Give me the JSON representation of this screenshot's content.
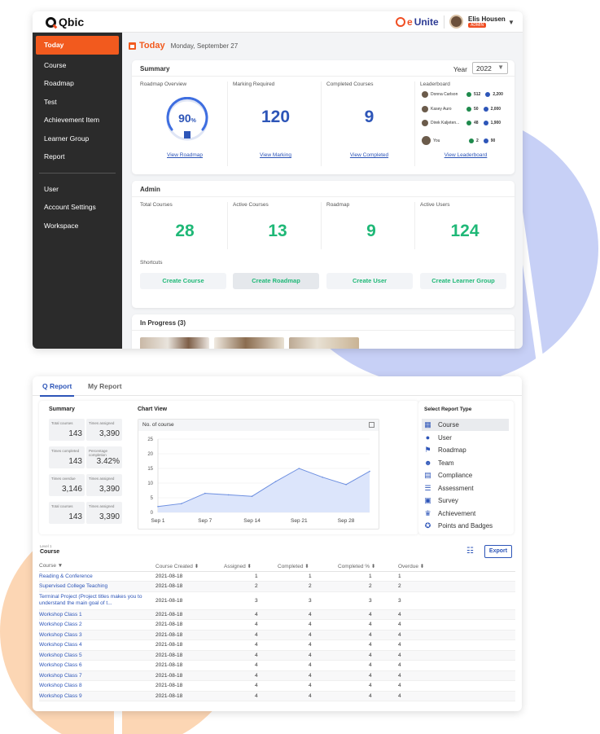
{
  "colors": {
    "accent": "#f25a1e",
    "brand_blue": "#2d55b8",
    "green": "#1fb877"
  },
  "app": {
    "logo": "Qbic",
    "partner_logo_e": "e",
    "partner_logo_rest": "Unite"
  },
  "user": {
    "name": "Elis Housen",
    "role": "ADMIN"
  },
  "sidebar": {
    "items": [
      "Today",
      "Course",
      "Roadmap",
      "Test",
      "Achievement Item",
      "Learner Group",
      "Report"
    ],
    "items2": [
      "User",
      "Account Settings",
      "Workspace"
    ]
  },
  "page": {
    "title": "Today",
    "date": "Monday, September 27"
  },
  "summary": {
    "heading": "Summary",
    "year_label": "Year",
    "year_value": "2022",
    "roadmap_title": "Roadmap Overview",
    "roadmap_percent": "90",
    "roadmap_unit": "%",
    "roadmap_link": "View Roadmap",
    "marking_title": "Marking Required",
    "marking_value": "120",
    "marking_link": "View Marking",
    "completed_title": "Completed Courses",
    "completed_value": "9",
    "completed_link": "View Completed",
    "leaderboard_title": "Leaderboard",
    "leaderboard_link": "View Leaderboard",
    "leaderboard": [
      {
        "name": "Donna Carlson",
        "g": "512",
        "b": "2,200"
      },
      {
        "name": "Kasey Auro",
        "g": "50",
        "b": "2,000"
      },
      {
        "name": "Direk Kaljeten...",
        "g": "48",
        "b": "1,900"
      },
      {
        "name": "You",
        "g": "2",
        "b": "90"
      }
    ]
  },
  "admin": {
    "heading": "Admin",
    "stats": [
      {
        "label": "Total Courses",
        "value": "28"
      },
      {
        "label": "Active Courses",
        "value": "13"
      },
      {
        "label": "Roadmap",
        "value": "9"
      },
      {
        "label": "Active Users",
        "value": "124"
      }
    ],
    "shortcuts_label": "Shortcuts",
    "shortcuts": [
      "Create Course",
      "Create Roadmap",
      "Create User",
      "Create Learner Group"
    ]
  },
  "in_progress": {
    "heading": "In Progress (3)"
  },
  "report": {
    "tabs": [
      "Q Report",
      "My Report"
    ],
    "summary_title": "Summary",
    "stats": [
      {
        "label": "Total courses",
        "value": "143"
      },
      {
        "label": "Times assigned",
        "value": "3,390"
      },
      {
        "label": "Times completed",
        "value": "143"
      },
      {
        "label": "Percentage completion",
        "value": "3.42%"
      },
      {
        "label": "Times overdue",
        "value": "3,146"
      },
      {
        "label": "Times assigned",
        "value": "3,390"
      },
      {
        "label": "Total courses",
        "value": "143"
      },
      {
        "label": "Times assigned",
        "value": "3,390"
      }
    ],
    "chart_view_title": "Chart View",
    "chart_header": "No. of course",
    "select_type_title": "Select Report Type",
    "types": [
      {
        "label": "Course",
        "icon": "grid-icon"
      },
      {
        "label": "User",
        "icon": "user-icon"
      },
      {
        "label": "Roadmap",
        "icon": "roadmap-icon"
      },
      {
        "label": "Team",
        "icon": "team-icon"
      },
      {
        "label": "Compliance",
        "icon": "compliance-icon"
      },
      {
        "label": "Assessment",
        "icon": "list-icon"
      },
      {
        "label": "Survey",
        "icon": "survey-icon"
      },
      {
        "label": "Achievement",
        "icon": "trophy-icon"
      },
      {
        "label": "Points and Badges",
        "icon": "badge-icon"
      }
    ],
    "level_label": "Level 1",
    "table_title": "Course",
    "export_label": "Export",
    "columns": [
      "Course ▼",
      "Course Created ⬍",
      "Assigned ⬍",
      "Completed ⬍",
      "Completed % ⬍",
      "Overdue ⬍"
    ],
    "rows": [
      [
        "Reading & Conference",
        "2021-08-18",
        "1",
        "1",
        "1",
        "1"
      ],
      [
        "Supervised College Teaching",
        "2021-08-18",
        "2",
        "2",
        "2",
        "2"
      ],
      [
        "Terminal Project (Project titles makes you to understand the main goal of t...",
        "2021-08-18",
        "3",
        "3",
        "3",
        "3"
      ],
      [
        "Workshop Class 1",
        "2021-08-18",
        "4",
        "4",
        "4",
        "4"
      ],
      [
        "Workshop Class 2",
        "2021-08-18",
        "4",
        "4",
        "4",
        "4"
      ],
      [
        "Workshop Class 3",
        "2021-08-18",
        "4",
        "4",
        "4",
        "4"
      ],
      [
        "Workshop Class 4",
        "2021-08-18",
        "4",
        "4",
        "4",
        "4"
      ],
      [
        "Workshop Class 5",
        "2021-08-18",
        "4",
        "4",
        "4",
        "4"
      ],
      [
        "Workshop Class 6",
        "2021-08-18",
        "4",
        "4",
        "4",
        "4"
      ],
      [
        "Workshop Class 7",
        "2021-08-18",
        "4",
        "4",
        "4",
        "4"
      ],
      [
        "Workshop Class 8",
        "2021-08-18",
        "4",
        "4",
        "4",
        "4"
      ],
      [
        "Workshop Class 9",
        "2021-08-18",
        "4",
        "4",
        "4",
        "4"
      ]
    ]
  },
  "chart_data": {
    "type": "area",
    "x": [
      "Sep 1",
      "Sep 4",
      "Sep 7",
      "Sep 11",
      "Sep 14",
      "Sep 18",
      "Sep 21",
      "Sep 25",
      "Sep 28",
      "Sep 30"
    ],
    "x_ticks": [
      "Sep 1",
      "Sep 7",
      "Sep 14",
      "Sep 21",
      "Sep 28"
    ],
    "values": [
      2,
      3,
      6.5,
      6,
      5.5,
      10.5,
      15,
      12,
      9.5,
      14
    ],
    "ylim": [
      0,
      25
    ],
    "y_ticks": [
      "0",
      "5",
      "10",
      "15",
      "20",
      "25"
    ],
    "title": "No. of course",
    "grid": true
  }
}
